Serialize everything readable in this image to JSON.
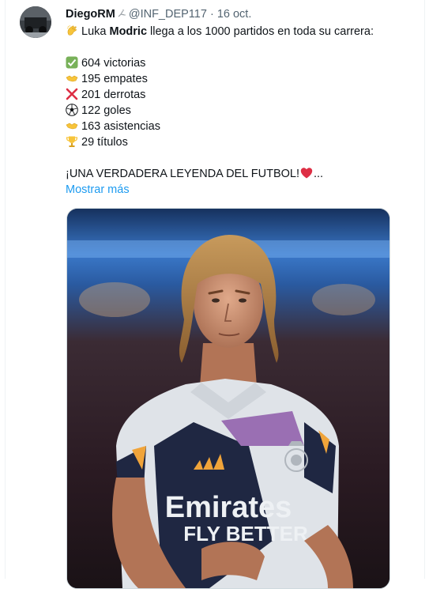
{
  "author": {
    "display_name": "DiegoRM",
    "handle": "@INF_DEP117",
    "separator": "·",
    "date": "16 oct."
  },
  "tweet": {
    "intro_prefix": "Luka ",
    "intro_bold": "Modric",
    "intro_suffix": " llega a los 1000 partidos en toda su carrera:",
    "stats": [
      {
        "icon": "check-icon",
        "text": "604 victorias"
      },
      {
        "icon": "handshake-icon",
        "text": "195 empates"
      },
      {
        "icon": "cross-icon",
        "text": "201 derrotas"
      },
      {
        "icon": "soccer-ball-icon",
        "text": "122 goles"
      },
      {
        "icon": "handshake-icon",
        "text": "163 asistencias"
      },
      {
        "icon": "trophy-icon",
        "text": "29 títulos"
      }
    ],
    "closing": "¡UNA VERDADERA LEYENDA DEL FUTBOL!",
    "ellipsis": "...",
    "show_more": "Mostrar más"
  },
  "media": {
    "alt": "Luka Modric photo",
    "jersey_text_line1": "Emirates",
    "jersey_text_line2": "FLY BETTER"
  },
  "colors": {
    "link": "#1d9bf0",
    "muted": "#536471",
    "text": "#0f1419"
  }
}
